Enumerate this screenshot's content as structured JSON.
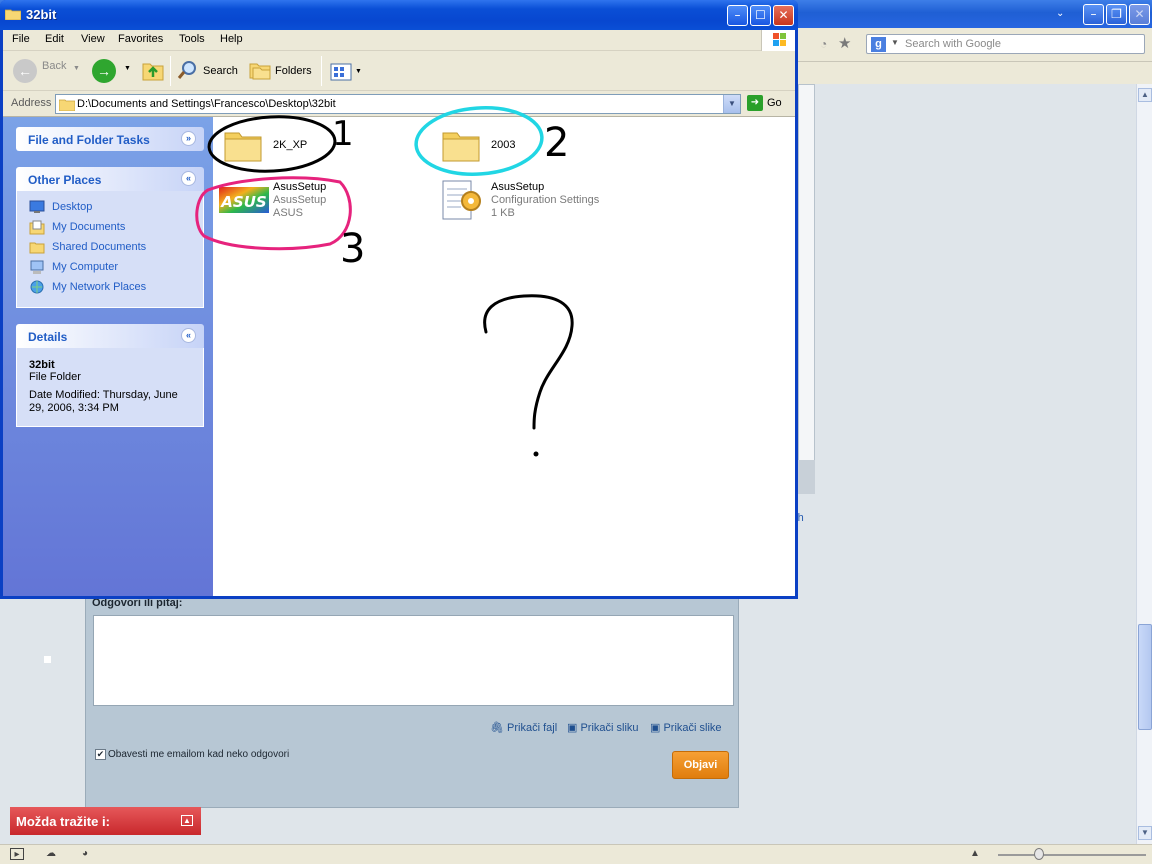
{
  "explorer": {
    "title": "32bit",
    "menu": [
      "File",
      "Edit",
      "View",
      "Favorites",
      "Tools",
      "Help"
    ],
    "toolbar": {
      "back": "Back",
      "search": "Search",
      "folders": "Folders"
    },
    "address": {
      "label": "Address",
      "path": "D:\\Documents and Settings\\Francesco\\Desktop\\32bit",
      "go": "Go"
    },
    "tasks": {
      "file_folder_tasks": "File and Folder Tasks",
      "other_places": {
        "title": "Other Places",
        "items": [
          "Desktop",
          "My Documents",
          "Shared Documents",
          "My Computer",
          "My Network Places"
        ]
      },
      "details": {
        "title": "Details",
        "name": "32bit",
        "type": "File Folder",
        "date_modified": "Date Modified: Thursday, June 29, 2006, 3:34 PM"
      }
    },
    "items": [
      {
        "name": "2K_XP"
      },
      {
        "name": "2003"
      },
      {
        "name": "AsusSetup",
        "line2": "AsusSetup",
        "line3": "ASUS"
      },
      {
        "name": "AsusSetup",
        "line2": "Configuration Settings",
        "line3": "1 KB"
      }
    ]
  },
  "annotations": {
    "labels": [
      "1",
      "2",
      "3"
    ],
    "question_mark": "?",
    "colors": {
      "one": "#000000",
      "two": "#21d6e4",
      "three": "#e6237d"
    }
  },
  "browser": {
    "search_placeholder": "Search with Google",
    "link_fragment": "rh",
    "form": {
      "label": "Odgovori ili pitaj:",
      "attach_file": "Prikači fajl",
      "attach_image": "Prikači sliku",
      "attach_images": "Prikači slike",
      "notify_label": "Obavesti me emailom kad neko odgovori",
      "notify_checked": true,
      "submit": "Objavi"
    },
    "suggestions_bar": "Možda tražite i:"
  },
  "colors": {
    "xp_title_blue": "#0a4fd6",
    "task_link": "#215dc6",
    "objavi_orange": "#e98b16",
    "suggestions_red": "#d2383b"
  }
}
